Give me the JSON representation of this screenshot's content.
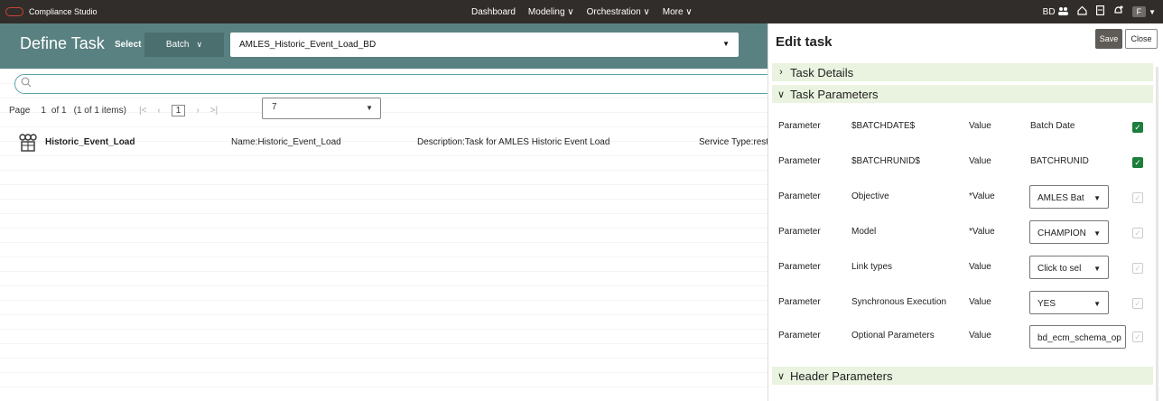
{
  "topbar": {
    "brand": "Compliance Studio",
    "nav": [
      "Dashboard",
      "Modeling ∨",
      "Orchestration ∨",
      "More ∨"
    ],
    "user_initials": "BD",
    "user_chip": "F"
  },
  "page": {
    "title": "Define Task",
    "select_label": "Select",
    "batch_button": "Batch",
    "batch_value": "AMLES_Historic_Event_Load_BD"
  },
  "pager": {
    "page_label": "Page",
    "page_num": "1",
    "of_text": "of 1",
    "items_text": "(1 of 1 items)",
    "current_page": "1",
    "page_size": "7"
  },
  "tasks": [
    {
      "name": "Historic_Event_Load",
      "col1": "Name:Historic_Event_Load",
      "col2": "Description:Task for AMLES Historic Event Load",
      "col3": "Service Type:rest"
    }
  ],
  "edit": {
    "title": "Edit task",
    "save": "Save",
    "close": "Close",
    "sections": {
      "details": "Task Details",
      "params": "Task Parameters",
      "header": "Header Parameters"
    },
    "params": [
      {
        "label": "Parameter",
        "name": "$BATCHDATE$",
        "vlabel": "Value",
        "value": "Batch Date",
        "kind": "text",
        "checked": true
      },
      {
        "label": "Parameter",
        "name": "$BATCHRUNID$",
        "vlabel": "Value",
        "value": "BATCHRUNID",
        "kind": "text",
        "checked": true
      },
      {
        "label": "Parameter",
        "name": "Objective",
        "vlabel": "*Value",
        "value": "AMLES Bat",
        "kind": "select",
        "checked": false
      },
      {
        "label": "Parameter",
        "name": "Model",
        "vlabel": "*Value",
        "value": "CHAMPION",
        "kind": "select",
        "checked": false
      },
      {
        "label": "Parameter",
        "name": "Link types",
        "vlabel": "Value",
        "value": "Click to sel",
        "kind": "select",
        "checked": false
      },
      {
        "label": "Parameter",
        "name": "Synchronous Execution",
        "vlabel": "Value",
        "value": "YES",
        "kind": "select",
        "checked": false
      },
      {
        "label": "Parameter",
        "name": "Optional Parameters",
        "vlabel": "Value",
        "value": "bd_ecm_schema_op",
        "kind": "input",
        "checked": false
      }
    ]
  },
  "colors": {
    "topbar": "#312d2a",
    "titlebar": "#5a8181",
    "section_bg": "#e9f3df",
    "check_on": "#1c7d3c"
  }
}
